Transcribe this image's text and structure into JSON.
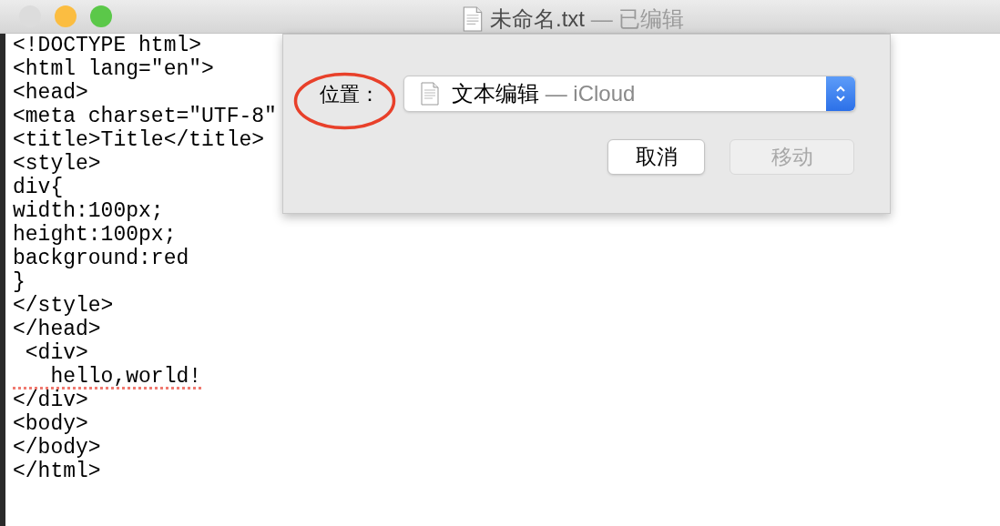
{
  "window": {
    "traffic_lights": [
      {
        "color": "#dcdcdc"
      },
      {
        "color": "#fbbd41"
      },
      {
        "color": "#5bc849"
      }
    ],
    "title": {
      "name": "未命名.txt",
      "status": "— 已编辑"
    }
  },
  "editor": {
    "lines": [
      {
        "text": "<!DOCTYPE html>",
        "misspelled": false
      },
      {
        "text": "<html lang=\"en\">",
        "misspelled": false
      },
      {
        "text": "<head>",
        "misspelled": false
      },
      {
        "text": "<meta charset=\"UTF-8\"",
        "misspelled": false
      },
      {
        "text": "<title>Title</title>",
        "misspelled": false
      },
      {
        "text": "<style>",
        "misspelled": false
      },
      {
        "text": "div{",
        "misspelled": false
      },
      {
        "text": "width:100px;",
        "misspelled": false
      },
      {
        "text": "height:100px;",
        "misspelled": false
      },
      {
        "text": "background:red",
        "misspelled": false
      },
      {
        "text": "}",
        "misspelled": false
      },
      {
        "text": "</style>",
        "misspelled": false
      },
      {
        "text": "</head>",
        "misspelled": false
      },
      {
        "text": " <div>",
        "misspelled": false
      },
      {
        "text": "   hello,world!",
        "misspelled": true
      },
      {
        "text": "</div>",
        "misspelled": false
      },
      {
        "text": "<body>",
        "misspelled": false
      },
      {
        "text": "</body>",
        "misspelled": false
      },
      {
        "text": "</html>",
        "misspelled": false
      }
    ]
  },
  "sheet": {
    "location_label": "位置：",
    "popup": {
      "app": "文本编辑",
      "location": "— iCloud"
    },
    "buttons": [
      {
        "label": "取消",
        "disabled": false
      },
      {
        "label": "移动",
        "disabled": true
      }
    ]
  }
}
